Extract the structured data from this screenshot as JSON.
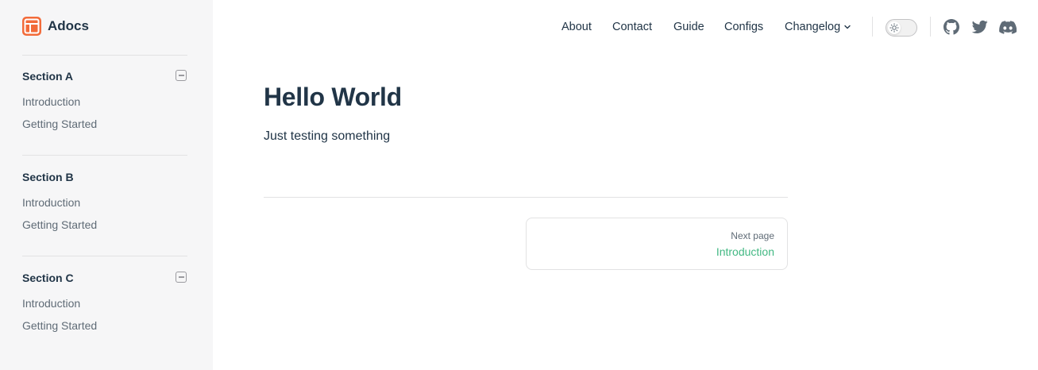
{
  "brand": {
    "name": "Adocs"
  },
  "nav": {
    "links": [
      "About",
      "Contact",
      "Guide",
      "Configs"
    ],
    "changelog": "Changelog"
  },
  "social": [
    "github-icon",
    "twitter-icon",
    "discord-icon"
  ],
  "sidebar": {
    "sections": [
      {
        "title": "Section A",
        "collapsible": true,
        "items": [
          "Introduction",
          "Getting Started"
        ]
      },
      {
        "title": "Section B",
        "collapsible": false,
        "items": [
          "Introduction",
          "Getting Started"
        ]
      },
      {
        "title": "Section C",
        "collapsible": true,
        "items": [
          "Introduction",
          "Getting Started"
        ]
      }
    ]
  },
  "main": {
    "title": "Hello World",
    "text": "Just testing something"
  },
  "pager": {
    "next_desc": "Next page",
    "next_title": "Introduction"
  },
  "colors": {
    "accent": "#42b883",
    "brand": "#f26b3a",
    "sidebar_bg": "#f6f6f7",
    "text": "#213547"
  }
}
